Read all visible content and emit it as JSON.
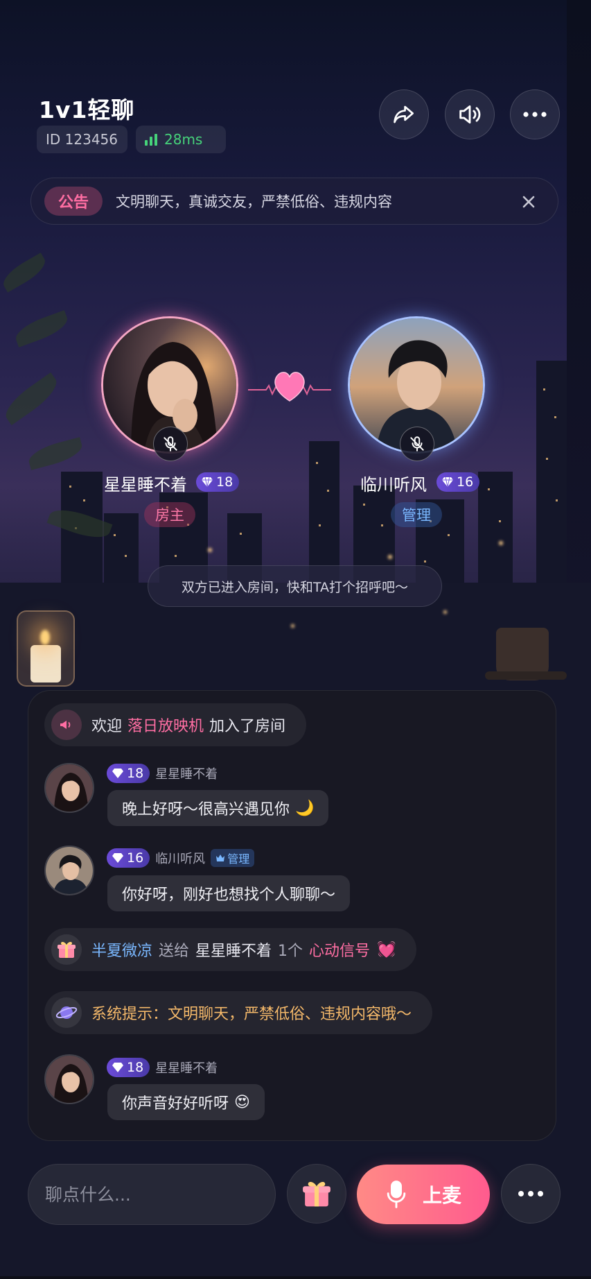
{
  "header": {
    "title": "1v1轻聊",
    "room_id": "ID 123456",
    "ping": "28ms"
  },
  "notice": {
    "tag": "公告",
    "text": "文明聊天，真诚交友，严禁低俗、违规内容"
  },
  "seats": [
    {
      "name": "星星睡不着",
      "level": "18",
      "role": "房主"
    },
    {
      "name": "临川听风",
      "level": "16",
      "role": "管理"
    }
  ],
  "hint": "双方已进入房间，快和TA打个招呼吧～",
  "chat": {
    "welcome": {
      "prefix": "欢迎",
      "user": "落日放映机",
      "suffix": "加入了房间"
    },
    "messages": [
      {
        "level": "18",
        "name": "星星睡不着",
        "text": "晚上好呀～很高兴遇见你",
        "emoji": "🌙"
      },
      {
        "level": "16",
        "name": "临川听风",
        "badge": "管理",
        "text": "你好呀，刚好也想找个人聊聊～"
      },
      {
        "level": "18",
        "name": "星星睡不着",
        "text": "你声音好好听呀",
        "emoji": "😍"
      }
    ],
    "gift": {
      "sender": "半夏微凉",
      "verb": "送给",
      "receiver": "星星睡不着",
      "count": "1个",
      "item": "心动信号",
      "emoji": "💓"
    },
    "system": "系统提示：文明聊天，严禁低俗、违规内容哦～"
  },
  "bottom": {
    "input_placeholder": "聊点什么...",
    "mic_label": "上麦"
  },
  "colors": {
    "pink_accent": "#ff6ea3",
    "blue_accent": "#7ab8ff",
    "gold_text": "#f5b96a",
    "ping_green": "#46d37a"
  }
}
